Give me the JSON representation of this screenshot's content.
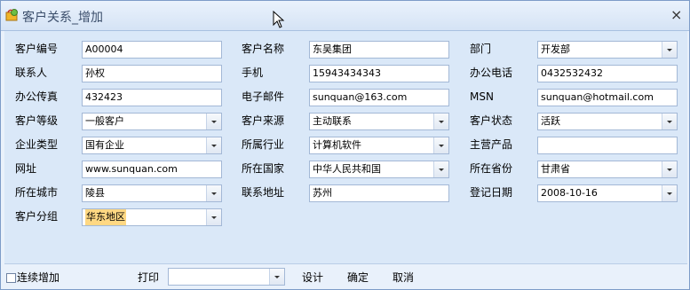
{
  "window": {
    "title": "客户关系_增加",
    "close": "×"
  },
  "fields": {
    "customer_no": {
      "label": "客户编号",
      "value": "A00004"
    },
    "customer_name": {
      "label": "客户名称",
      "value": "东吴集团"
    },
    "department": {
      "label": "部门",
      "value": "开发部"
    },
    "contact": {
      "label": "联系人",
      "value": "孙权"
    },
    "mobile": {
      "label": "手机",
      "value": "15943434343"
    },
    "office_phone": {
      "label": "办公电话",
      "value": "0432532432"
    },
    "office_fax": {
      "label": "办公传真",
      "value": "432423"
    },
    "email": {
      "label": "电子邮件",
      "value": "sunquan@163.com"
    },
    "msn": {
      "label": "MSN",
      "value": "sunquan@hotmail.com"
    },
    "customer_level": {
      "label": "客户等级",
      "value": "一般客户"
    },
    "customer_source": {
      "label": "客户来源",
      "value": "主动联系"
    },
    "customer_status": {
      "label": "客户状态",
      "value": "活跃"
    },
    "company_type": {
      "label": "企业类型",
      "value": "国有企业"
    },
    "industry": {
      "label": "所属行业",
      "value": "计算机软件"
    },
    "main_product": {
      "label": "主营产品",
      "value": ""
    },
    "website": {
      "label": "网址",
      "value": "www.sunquan.com"
    },
    "country": {
      "label": "所在国家",
      "value": "中华人民共和国"
    },
    "province": {
      "label": "所在省份",
      "value": "甘肃省"
    },
    "city": {
      "label": "所在城市",
      "value": "陵县"
    },
    "address": {
      "label": "联系地址",
      "value": "苏州"
    },
    "reg_date": {
      "label": "登记日期",
      "value": "2008-10-16"
    },
    "customer_group": {
      "label": "客户分组",
      "value": "华东地区"
    }
  },
  "bottom": {
    "continuous_add": "连续增加",
    "print_label": "打印",
    "print_value": "",
    "design": "设计",
    "ok": "确定",
    "cancel": "取消"
  }
}
